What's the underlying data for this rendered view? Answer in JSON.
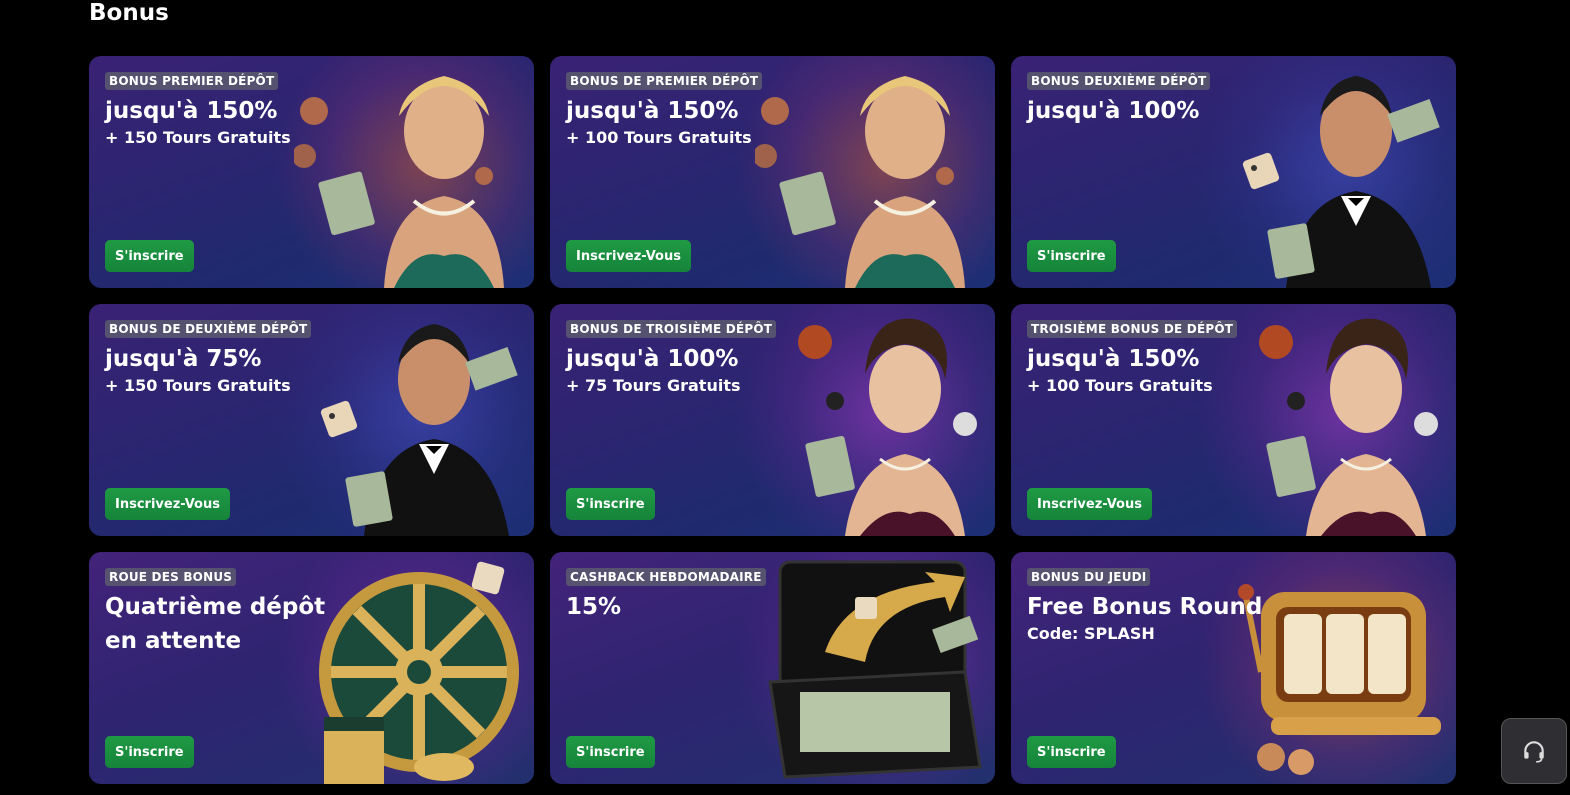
{
  "section": {
    "title": "Bonus"
  },
  "cards": [
    {
      "badge": "BONUS PREMIER DÉPÔT",
      "headline": "jusqu'à 150%",
      "sub": "+ 150 Tours Gratuits",
      "cta": "S'inscrire",
      "art": "woman-with-cash-and-coins"
    },
    {
      "badge": "BONUS DE PREMIER DÉPÔT",
      "headline": "jusqu'à 150%",
      "sub": "+ 100 Tours Gratuits",
      "cta": "Inscrivez-Vous",
      "art": "woman-with-cash-and-coins"
    },
    {
      "badge": "BONUS DEUXIÈME DÉPÔT",
      "headline": "jusqu'à 100%",
      "sub": "",
      "cta": "S'inscrire",
      "art": "man-in-tuxedo-with-dice"
    },
    {
      "badge": "BONUS DE DEUXIÈME DÉPÔT",
      "headline": "jusqu'à 75%",
      "sub": "+ 150 Tours Gratuits",
      "cta": "Inscrivez-Vous",
      "art": "man-in-tuxedo-with-dice"
    },
    {
      "badge": "BONUS DE TROISIÈME DÉPÔT",
      "headline": "jusqu'à 100%",
      "sub": "+ 75 Tours Gratuits",
      "cta": "S'inscrire",
      "art": "woman-with-cash-and-chips"
    },
    {
      "badge": "TROISIÈME BONUS DE DÉPÔT",
      "headline": "jusqu'à 150%",
      "sub": "+ 100 Tours Gratuits",
      "cta": "Inscrivez-Vous",
      "art": "woman-with-cash-and-chips"
    },
    {
      "badge": "ROUE DES BONUS",
      "headline": "Quatrième dépôt en attente",
      "sub": "",
      "cta": "S'inscrire",
      "art": "bonus-wheel-with-gift"
    },
    {
      "badge": "CASHBACK HEBDOMADAIRE",
      "headline": "15%",
      "sub": "",
      "cta": "S'inscrire",
      "art": "cash-briefcase-with-arrow"
    },
    {
      "badge": "BONUS DU JEUDI",
      "headline": "Free Bonus Round",
      "sub": "Code: SPLASH",
      "cta": "S'inscrire",
      "art": "golden-slot-machine"
    }
  ],
  "support": {
    "icon": "headset-icon"
  },
  "colors": {
    "background": "#000000",
    "cta": "#1a8f3f",
    "badge": "#5a5a6e"
  }
}
